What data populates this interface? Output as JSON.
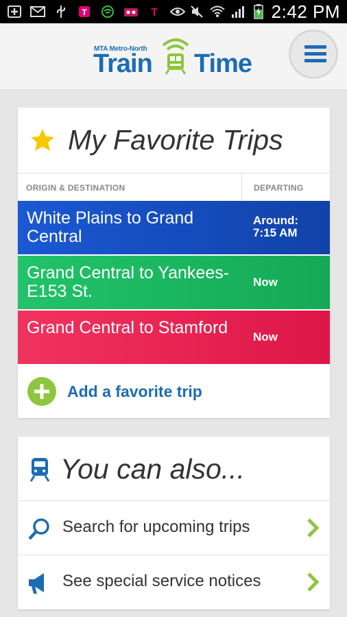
{
  "status_bar": {
    "time": "2:42 PM",
    "icons": [
      "add-box-icon",
      "mail-icon",
      "usb-icon",
      "tmobile-app-icon",
      "wifi-alt-icon",
      "bag-icon",
      "tmobile-icon",
      "eye-icon",
      "mute-icon",
      "wifi-icon",
      "signal-icon",
      "battery-charging-icon"
    ]
  },
  "header": {
    "logo_small": "MTA Metro-North",
    "logo_word1": "Train",
    "logo_word2": "Time",
    "menu_icon": "hamburger-icon"
  },
  "favorites": {
    "title": "My Favorite Trips",
    "title_icon": "star-icon",
    "col_origin": "ORIGIN & DESTINATION",
    "col_departing": "DEPARTING",
    "trips": [
      {
        "name": "White Plains to Grand Central",
        "departing_label": "Around:",
        "departing_time": "7:15 AM",
        "color": "#1a58d4"
      },
      {
        "name": "Grand Central to Yankees-E153 St.",
        "departing": "Now",
        "color": "#22c36a"
      },
      {
        "name": "Grand Central to Stamford",
        "departing": "Now",
        "color": "#f1335f"
      }
    ],
    "add_label": "Add a favorite trip",
    "add_icon": "plus-circle-icon"
  },
  "also": {
    "title": "You can also...",
    "title_icon": "train-icon",
    "options": [
      {
        "label": "Search for upcoming trips",
        "icon": "search-icon"
      },
      {
        "label": "See special service notices",
        "icon": "megaphone-icon"
      }
    ]
  },
  "colors": {
    "accent_blue": "#1c6cb3",
    "accent_green": "#8dc63f"
  }
}
